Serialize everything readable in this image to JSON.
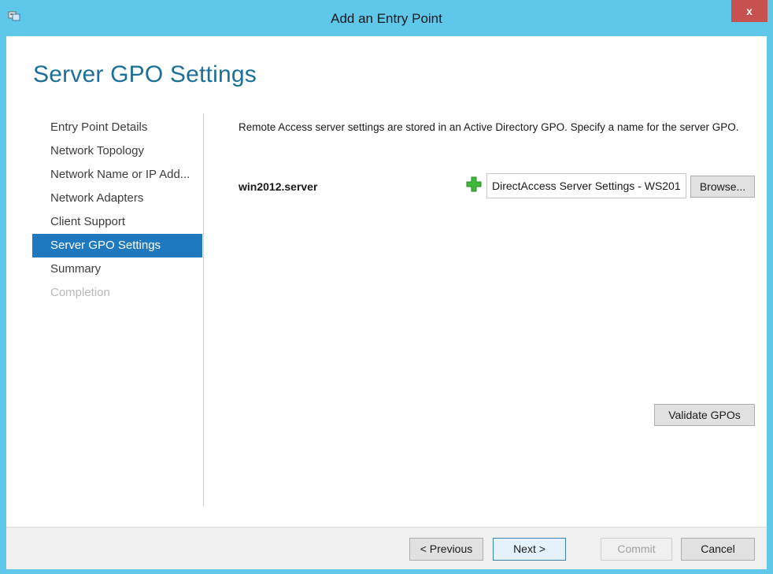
{
  "window": {
    "title": "Add an Entry Point",
    "close_label": "x"
  },
  "page_title": "Server GPO Settings",
  "nav": {
    "items": [
      {
        "label": "Entry Point Details",
        "state": "normal"
      },
      {
        "label": "Network Topology",
        "state": "normal"
      },
      {
        "label": "Network Name or IP Add...",
        "state": "normal"
      },
      {
        "label": "Network Adapters",
        "state": "normal"
      },
      {
        "label": "Client Support",
        "state": "normal"
      },
      {
        "label": "Server GPO Settings",
        "state": "selected"
      },
      {
        "label": "Summary",
        "state": "normal"
      },
      {
        "label": "Completion",
        "state": "disabled"
      }
    ]
  },
  "main": {
    "description": "Remote Access server settings are stored in an Active Directory GPO. Specify a name for the server GPO.",
    "server_name": "win2012.server",
    "gpo_name_value": "DirectAccess Server Settings - WS201",
    "browse_label": "Browse...",
    "validate_label": "Validate GPOs"
  },
  "footer": {
    "previous_label": "< Previous",
    "next_label": "Next >",
    "commit_label": "Commit",
    "cancel_label": "Cancel"
  },
  "colors": {
    "title_bar": "#5fc7ea",
    "page_title": "#1c6f98",
    "nav_selected": "#1e79c0",
    "close_button": "#c75050",
    "plus_icon": "#3db83a"
  },
  "icons": {
    "window_icon": "remote-access-icon",
    "add": "green-plus-icon"
  }
}
